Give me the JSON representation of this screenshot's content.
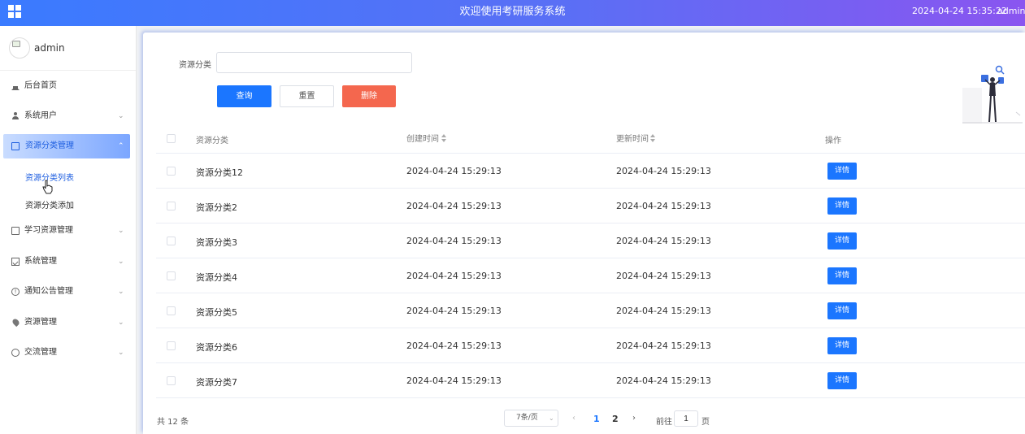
{
  "header": {
    "title": "欢迎使用考研服务系统",
    "datetime": "2024-04-24 15:35:22",
    "user": "admin",
    "user_caret": "⌄"
  },
  "sidebar": {
    "profile_name": "admin",
    "items": [
      {
        "label": "后台首页",
        "icon": "home-icon"
      },
      {
        "label": "系统用户",
        "icon": "user-icon",
        "chevron": "⌄"
      },
      {
        "label": "资源分类管理",
        "icon": "document-icon",
        "chevron": "⌃",
        "active": true
      },
      {
        "label": "学习资源管理",
        "icon": "document-icon",
        "chevron": "⌄"
      },
      {
        "label": "系统管理",
        "icon": "picture-icon",
        "chevron": "⌄"
      },
      {
        "label": "通知公告管理",
        "icon": "info-icon",
        "chevron": "⌄"
      },
      {
        "label": "资源管理",
        "icon": "location-pin-icon",
        "chevron": "⌄"
      },
      {
        "label": "交流管理",
        "icon": "chat-icon",
        "chevron": "⌄"
      }
    ],
    "sub_items": [
      {
        "label": "资源分类列表",
        "current": true
      },
      {
        "label": "资源分类添加"
      }
    ]
  },
  "search": {
    "label": "资源分类",
    "value": "",
    "placeholder": ""
  },
  "actions": {
    "query": "查询",
    "reset": "重置",
    "delete": "删除"
  },
  "table": {
    "columns": [
      "资源分类",
      "创建时间",
      "更新时间",
      "操作"
    ],
    "detail_label": "详情",
    "rows": [
      {
        "name": "资源分类12",
        "created": "2024-04-24 15:29:13",
        "updated": "2024-04-24 15:29:13"
      },
      {
        "name": "资源分类2",
        "created": "2024-04-24 15:29:13",
        "updated": "2024-04-24 15:29:13"
      },
      {
        "name": "资源分类3",
        "created": "2024-04-24 15:29:13",
        "updated": "2024-04-24 15:29:13"
      },
      {
        "name": "资源分类4",
        "created": "2024-04-24 15:29:13",
        "updated": "2024-04-24 15:29:13"
      },
      {
        "name": "资源分类5",
        "created": "2024-04-24 15:29:13",
        "updated": "2024-04-24 15:29:13"
      },
      {
        "name": "资源分类6",
        "created": "2024-04-24 15:29:13",
        "updated": "2024-04-24 15:29:13"
      },
      {
        "name": "资源分类7",
        "created": "2024-04-24 15:29:13",
        "updated": "2024-04-24 15:29:13"
      }
    ]
  },
  "pagination": {
    "total": "共 12 条",
    "page_size": "7条/页",
    "page_size_caret": "⌄",
    "prev": "‹",
    "pages": [
      "1",
      "2"
    ],
    "next": "›",
    "goto": "前往",
    "goto_value": "1",
    "unit": "页"
  },
  "colors": {
    "primary": "#1b76ff",
    "danger": "#f4674e",
    "header_start": "#3a7bff",
    "header_end": "#8a55f0"
  }
}
